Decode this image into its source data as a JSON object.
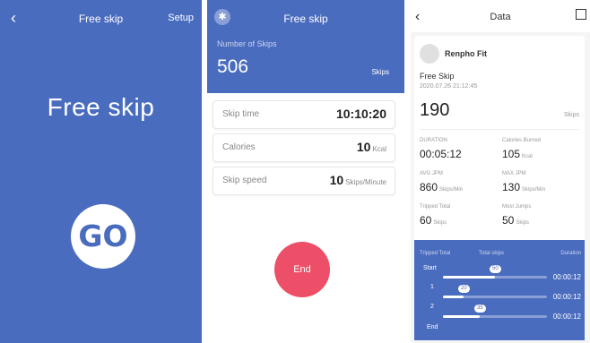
{
  "screen1": {
    "title": "Free skip",
    "setup_label": "Setup",
    "big_title": "Free skip",
    "go_label": "GO"
  },
  "screen2": {
    "title": "Free skip",
    "count_label": "Number of Skips",
    "count_value": "506",
    "count_unit": "Skips",
    "rows": [
      {
        "label": "Skip time",
        "value": "10:10:20",
        "unit": ""
      },
      {
        "label": "Calories",
        "value": "10",
        "unit": "Kcal"
      },
      {
        "label": "Skip speed",
        "value": "10",
        "unit": "Skips/Minute"
      }
    ],
    "end_label": "End"
  },
  "screen3": {
    "title": "Data",
    "user_name": "Renpho Fit",
    "mode": "Free Skip",
    "date": "2020.07.26 21:12:45",
    "total": "190",
    "total_unit": "Skips",
    "stats": [
      {
        "label": "DURATION",
        "value": "00:05:12",
        "unit": ""
      },
      {
        "label": "Calories Burned",
        "value": "105",
        "unit": "Kcal"
      },
      {
        "label": "AVG JPM",
        "value": "860",
        "unit": "Skips/Min"
      },
      {
        "label": "MAX JPM",
        "value": "130",
        "unit": "Skips/Min"
      },
      {
        "label": "Tripped Total",
        "value": "60",
        "unit": "Skips"
      },
      {
        "label": "Most Jumps",
        "value": "50",
        "unit": "Skips"
      }
    ],
    "seg_headers": {
      "tripped": "Tripped Total",
      "total": "Total skips",
      "duration": "Duration"
    },
    "segments": [
      {
        "label": "Start",
        "skips": "50",
        "duration": "00:00:12",
        "fraction": 0.5
      },
      {
        "label": "1",
        "skips": "20",
        "duration": "00:00:12",
        "fraction": 0.2
      },
      {
        "label": "2",
        "skips": "35",
        "duration": "00:00:12",
        "fraction": 0.35
      }
    ],
    "end_label": "End"
  }
}
